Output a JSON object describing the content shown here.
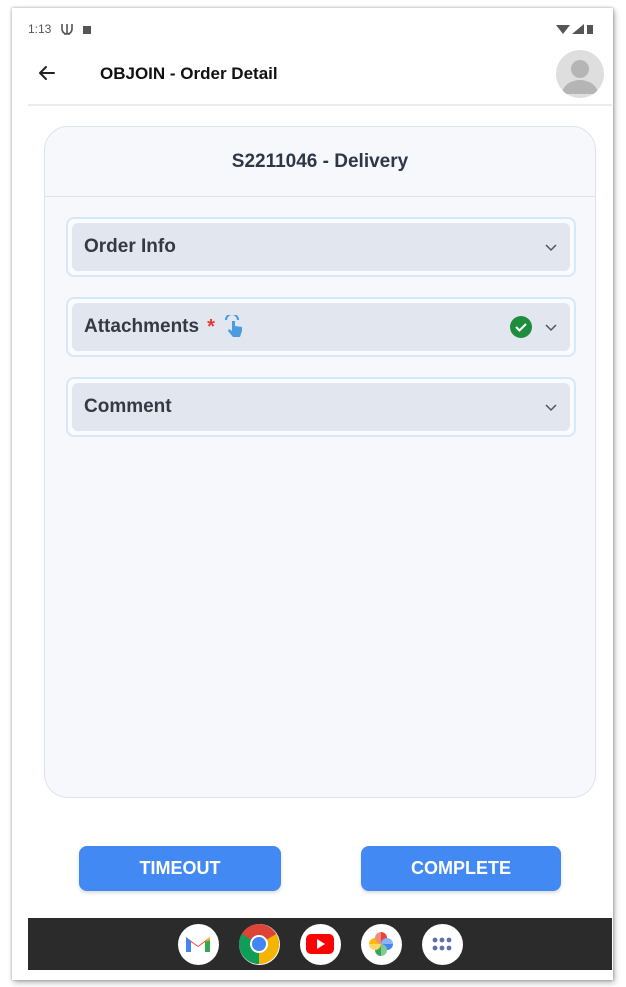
{
  "status_bar": {
    "time": "1:13"
  },
  "app_bar": {
    "title": "OBJOIN - Order Detail"
  },
  "card": {
    "header": "S2211046 - Delivery"
  },
  "sections": [
    {
      "label": "Order Info",
      "required": false,
      "completed": false,
      "icon": "chevron-down-icon"
    },
    {
      "label": "Attachments",
      "required": true,
      "required_mark": "*",
      "completed": true,
      "icon": "chevron-down-icon"
    },
    {
      "label": "Comment",
      "required": false,
      "completed": false,
      "icon": "chevron-down-icon"
    }
  ],
  "buttons": {
    "timeout": "TIMEOUT",
    "complete": "COMPLETE"
  },
  "dock": [
    "gmail-icon",
    "chrome-icon",
    "youtube-icon",
    "photos-icon",
    "apps-icon"
  ],
  "colors": {
    "primary": "#4289f4",
    "success": "#1e8e3e",
    "required": "#e53935",
    "nav_bg": "#2b2b2b"
  }
}
